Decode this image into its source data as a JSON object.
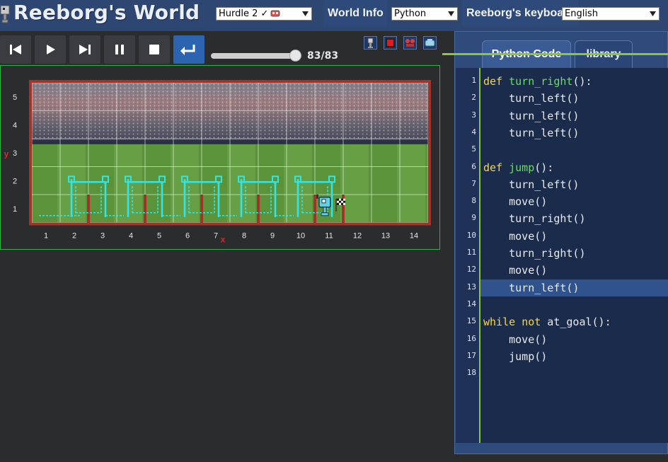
{
  "header": {
    "app_title": "Reeborg's World",
    "world_select": {
      "value": "Hurdle 2 ✓"
    },
    "world_info_label": "World Info",
    "language_select": {
      "value": "Python"
    },
    "keyboard_label": "Reeborg's keyboard",
    "ui_language_select": {
      "value": "English"
    },
    "colors": {
      "bar": "#2d4672",
      "tab": "#2e4a7a"
    }
  },
  "toolbar": {
    "buttons": [
      {
        "name": "reverse-step",
        "icon": "skip-back-icon"
      },
      {
        "name": "run",
        "icon": "play-icon"
      },
      {
        "name": "step",
        "icon": "skip-forward-icon"
      },
      {
        "name": "pause",
        "icon": "pause-icon"
      },
      {
        "name": "stop",
        "icon": "stop-icon"
      },
      {
        "name": "reload",
        "icon": "return-arrow-icon"
      }
    ],
    "step_counter": "83/83",
    "progress": 1.0,
    "world_tools": [
      "robot-icon",
      "red-square-icon",
      "robots-icon",
      "world-edit-icon"
    ]
  },
  "world": {
    "y_axis_label": "y",
    "x_axis_label": "x",
    "x_ticks": [
      "1",
      "2",
      "3",
      "4",
      "5",
      "6",
      "7",
      "8",
      "9",
      "10",
      "11",
      "12",
      "13",
      "14"
    ],
    "y_ticks": [
      "1",
      "2",
      "3",
      "4",
      "5"
    ],
    "grid": {
      "cols": 14,
      "rows": 5
    },
    "hurdle_positions_x": [
      2,
      4,
      6,
      8,
      10,
      11
    ],
    "robot": {
      "x": 11,
      "y": 1,
      "facing": "north"
    },
    "goal": {
      "x": 11,
      "y": 1
    },
    "colors": {
      "wall": "#a33228",
      "trace": "#2fe6e6",
      "frame": "#2bb34a"
    }
  },
  "editor": {
    "tabs": [
      {
        "label": "Python Code",
        "active": true
      },
      {
        "label": "library",
        "active": false
      }
    ],
    "highlighted_line": 13,
    "lines": [
      "def turn_right():",
      "    turn_left()",
      "    turn_left()",
      "    turn_left()",
      "",
      "def jump():",
      "    turn_left()",
      "    move()",
      "    turn_right()",
      "    move()",
      "    turn_right()",
      "    move()",
      "    turn_left()",
      "",
      "while not at_goal():",
      "    move()",
      "    jump()",
      ""
    ],
    "colors": {
      "keyword": "#f6d64a",
      "function": "#6cd96a",
      "gutter_rule": "#8cc63f"
    }
  }
}
